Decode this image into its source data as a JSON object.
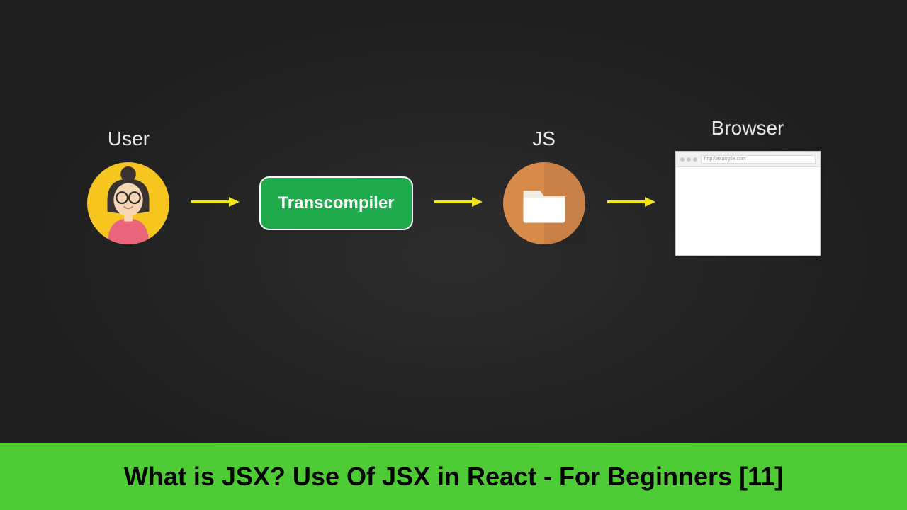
{
  "diagram": {
    "nodes": {
      "user": {
        "label": "User"
      },
      "transcompiler": {
        "label": "Transcompiler"
      },
      "js": {
        "label": "JS"
      },
      "browser": {
        "label": "Browser",
        "url": "http://example.com"
      }
    },
    "arrowColor": "#f2e415"
  },
  "title": "What is JSX? Use Of JSX in React - For Beginners [11]",
  "colors": {
    "bannerBg": "#4fcc35",
    "transcompilerBg": "#1ea94a",
    "avatarBg": "#f4c61f",
    "folderBg": "#d88a4a"
  }
}
